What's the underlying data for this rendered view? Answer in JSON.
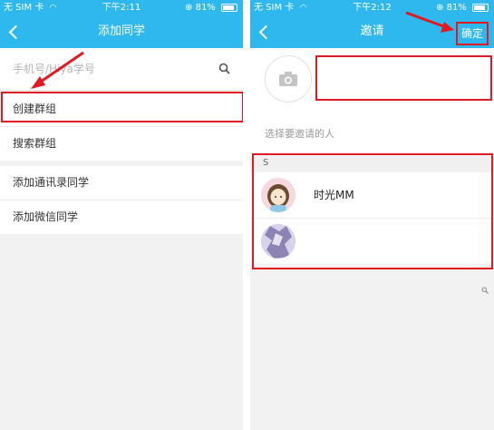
{
  "left": {
    "status": {
      "carrier": "无 SIM 卡",
      "time": "下午2:11",
      "battery": "81%"
    },
    "nav": {
      "title": "添加同学"
    },
    "search": {
      "placeholder": "手机号/Hiya学号"
    },
    "items": [
      "创建群组",
      "搜索群组",
      "添加通讯录同学",
      "添加微信同学"
    ]
  },
  "right": {
    "status": {
      "carrier": "无 SIM 卡",
      "time": "下午2:12",
      "battery": "81%"
    },
    "nav": {
      "title": "邀请",
      "confirm": "确定"
    },
    "hint": "选择要邀请的人",
    "section_letter": "S",
    "contacts": [
      {
        "name": "时光MM"
      },
      {
        "name": ""
      }
    ]
  },
  "colors": {
    "header": "#2fb8ee",
    "annotation": "#e01a22"
  }
}
